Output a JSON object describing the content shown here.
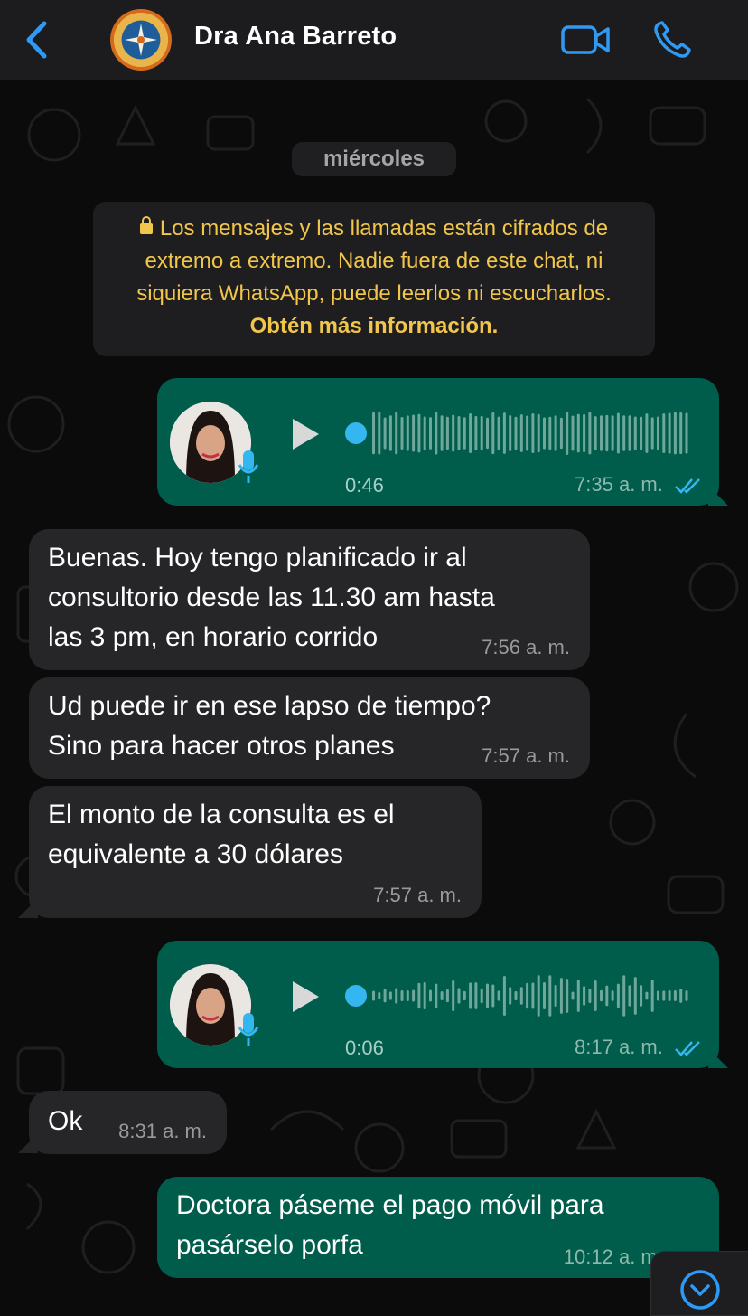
{
  "header": {
    "back_icon": "chevron-left-icon",
    "contact_name": "Dra Ana Barreto",
    "video_icon": "video-camera-icon",
    "call_icon": "phone-icon",
    "accent": "#2f9af5"
  },
  "day_chip": "miércoles",
  "encryption": {
    "icon": "lock-icon",
    "text": "Los mensajes y las llamadas están cifrados de extremo a extremo. Nadie fuera de este chat, ni siquiera WhatsApp, puede leerlos ni escucharlos.",
    "link": "Obtén más información."
  },
  "messages": [
    {
      "type": "voice",
      "direction": "out",
      "duration": "0:46",
      "time": "7:35 a. m.",
      "read": true
    },
    {
      "type": "text",
      "direction": "in",
      "text": "Buenas.  Hoy tengo planificado ir al\nconsultorio desde las 11.30 am hasta\nlas 3 pm, en horario corrido",
      "time": "7:56 a. m."
    },
    {
      "type": "text",
      "direction": "in",
      "text": "Ud puede ir en ese lapso de tiempo?\nSino para hacer otros planes",
      "time": "7:57 a. m."
    },
    {
      "type": "text",
      "direction": "in",
      "text": "El monto de la consulta es el\nequivalente a 30 dólares",
      "time": "7:57 a. m."
    },
    {
      "type": "voice",
      "direction": "out",
      "duration": "0:06",
      "time": "8:17 a. m.",
      "read": true
    },
    {
      "type": "text",
      "direction": "in",
      "text": "Ok",
      "time": "8:31 a. m."
    },
    {
      "type": "text",
      "direction": "out",
      "text": "Doctora páseme el pago móvil para\npasárselo porfa",
      "time": "10:12 a. m."
    }
  ],
  "scroll_button_icon": "chevron-down-circle-icon",
  "colors": {
    "outgoing": "#005c4b",
    "incoming": "#262628",
    "system_text": "#f2c64a",
    "ticks": "#34b7f1"
  }
}
